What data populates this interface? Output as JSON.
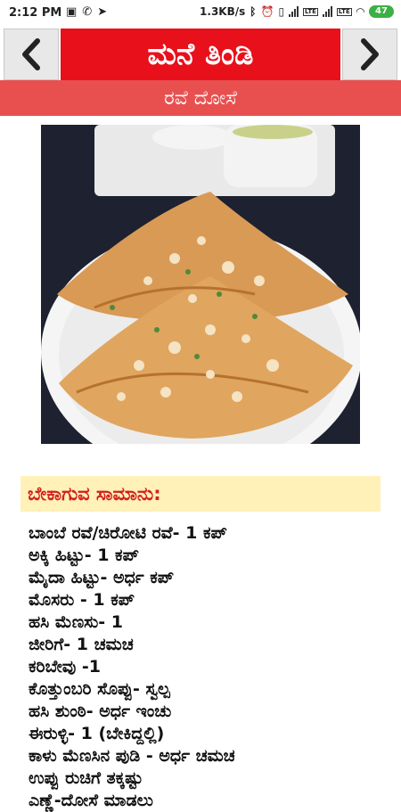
{
  "status_bar": {
    "time": "2:12 PM",
    "speed": "1.3KB/s",
    "lte1": "LTE",
    "lte2": "LTE",
    "battery": "47"
  },
  "header": {
    "title": "ಮನೆ ತಿಂಡಿ",
    "prev_icon": "chevron-left-icon",
    "next_icon": "chevron-right-icon"
  },
  "recipe": {
    "name": "ರವೆ ದೋಸೆ"
  },
  "ingredients": {
    "heading": "ಬೇಕಾಗುವ ಸಾಮಾನು:",
    "items": [
      "ಬಾಂಬೆ ರವೆ/ಚಿರೋಟಿ ರವೆ- 1 ಕಪ್",
      "ಅಕ್ಕಿ ಹಿಟ್ಟು- 1 ಕಪ್",
      "ಮೈದಾ ಹಿಟ್ಟು- ಅರ್ಧ ಕಪ್",
      "ಮೊಸರು - 1 ಕಪ್",
      "ಹಸಿ ಮೆಣಸು- 1",
      "ಜೀರಿಗೆ- 1 ಚಮಚ",
      "ಕರಿಬೇವು -1",
      "ಕೊತ್ತುಂಬರಿ ಸೊಪ್ಪು- ಸ್ವಲ್ಪ",
      "ಹಸಿ ಶುಂಠಿ- ಅರ್ಧ ಇಂಚು",
      "ಈರುಳ್ಳಿ- 1 (ಬೇಕಿದ್ದಲ್ಲಿ)",
      "ಕಾಳು ಮೆಣಸಿನ ಪುಡಿ - ಅರ್ಧ ಚಮಚ",
      "ಉಪ್ಪು ರುಚಿಗೆ ತಕ್ಕಷ್ಟು",
      "ಎಣ್ಣೆ-ದೋಸೆ ಮಾಡಲು"
    ]
  },
  "colors": {
    "title_bar": "#e8101a",
    "subtitle_bar": "#e85050",
    "heading_bg": "#fff1b8",
    "heading_text": "#d2201e"
  }
}
